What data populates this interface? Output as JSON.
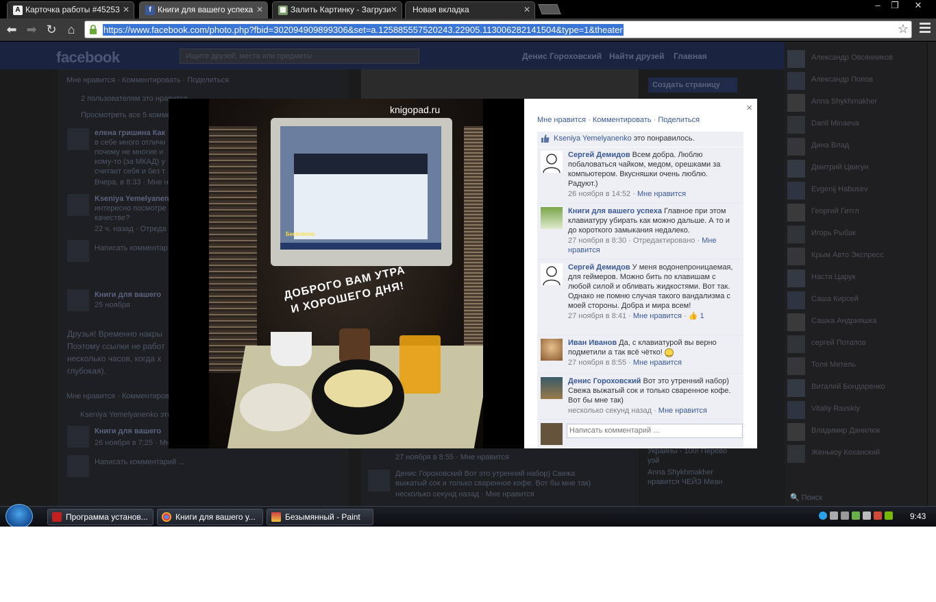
{
  "browser": {
    "tabs": [
      {
        "label": "Карточка работы #45253",
        "icon": "avast-favicon-icon"
      },
      {
        "label": "Книги для вашего успеха",
        "icon": "facebook-favicon-icon",
        "active": true
      },
      {
        "label": "Залить Картинку - Загрузи",
        "icon": "image-host-favicon-icon"
      },
      {
        "label": "Новая вкладка",
        "icon": ""
      }
    ],
    "url": "https://www.facebook.com/photo.php?fbid=302094909899306&set=a.125885557520243.22905.113006282141504&type=1&theater",
    "window_controls": [
      "–",
      "❐",
      "✕"
    ]
  },
  "background": {
    "logo": "facebook",
    "search_placeholder": "Ищите друзей, места или предметы",
    "header_user": "Денис Гороховский",
    "header_find": "Найти друзей",
    "header_home": "Главная",
    "create_page": "Создать страницу",
    "left_lines": [
      "Мне нравится · Комментировать · Поделиться",
      "2 пользователям это нравится.",
      "Просмотреть все 5 комментариев",
      "елена гришина Как",
      "в себе много отличн",
      "почему не многие и",
      "кому-то (за МКАД) у",
      "считает себя и без т",
      "Вчера, в 8:33 · Мне н",
      "Kseniya Yemelyanen",
      "интересно посмотре",
      "качестве?",
      "22 ч. назад · Отреда",
      "Написать комментар",
      "Книги для вашего",
      "25 ноября",
      "Друзья! Временно накры",
      "Поэтому ссылки не работ",
      "несколько часов, когда х",
      "глубокая).",
      "Мне нравится · Комментиров",
      "Kseniya Yemelyanenko это",
      "Книги для вашего",
      "26 ноября в 7:25 · Мн",
      "Написать комментарий ..."
    ],
    "right_lines": [
      "27 ноября в 8:55 · Мне нравится",
      "Денис Гороховский Вот это утренний набор) Свежа",
      "выжатый сок и только сваренное кофе. Вот бы мне так)",
      "несколько секунд назад · Мне нравится"
    ],
    "ad_lines": [
      "Украины - 100! Перево",
      "уэй",
      "Anna Shykhmakher",
      "нравится ЧЕЙЗ Меан"
    ],
    "chat_contacts": [
      "Александр Овсянников",
      "Александр Попов",
      "Anna Shykhmakher",
      "Danil Minaeva",
      "Дина Влад",
      "Дмитрий Цвигун",
      "Evgenij Habusev",
      "Георгий Гитгл",
      "Игорь Рыбак",
      "Крым Авто Экспресс",
      "Настя Царук",
      "Саша Кирсей",
      "Сашка Андрияшка",
      "сергей Потапов",
      "Толя Метель",
      "Виталий Бондаренко",
      "Vitaliy Ravskiy",
      "Владимир Данилюк",
      "Женькоу Коханский"
    ],
    "chat_search": "Поиск"
  },
  "photo": {
    "watermark": "knigopad.ru",
    "greeting_line1": "ДОБРОГО ВАМ УТРА",
    "greeting_line2": "И ХОРОШЕГО ДНЯ!",
    "screen_text": "Бесплатно"
  },
  "panel": {
    "close": "×",
    "actions": {
      "like": "Мне нравится",
      "comment": "Комментировать",
      "share": "Поделиться"
    },
    "likes": {
      "name": "Kseniya Yemelyanenko",
      "text": "это понравилось."
    },
    "comments": [
      {
        "author": "Сергей Демидов",
        "text": "Всем добра. Люблю побаловаться чайком, медом, орешками за компьютером. Вкусняшки очень люблю. Радуют.)",
        "time": "26 ноября в 14:52",
        "extra": "",
        "like": "Мне нравится",
        "count": ""
      },
      {
        "author": "Книги для вашего успеха",
        "text": "Главное при этом клавиатуру убирать как можно дальше. А то и до короткого замыкания недалеко.",
        "time": "27 ноября в 8:30",
        "extra": "Отредактировано",
        "like": "Мне нравится",
        "count": ""
      },
      {
        "author": "Сергей Демидов",
        "text": "У меня водонепроницаемая, для геймеров. Можно бить по клавишам с любой силой и обливать жидкостями. Вот так. Однако не помню случая такого вандализма с моей стороны. Добра и мира всем!",
        "time": "27 ноября в 8:41",
        "extra": "",
        "like": "Мне нравится",
        "count": "1"
      },
      {
        "author": "Иван Иванов",
        "text": "Да, с клавиатурой вы верно подметили а так всё чётко!",
        "time": "27 ноября в 8:55",
        "extra": "",
        "like": "Мне нравится",
        "count": ""
      },
      {
        "author": "Денис Гороховский",
        "text": "Вот это утренний набор) Свежа выжатый сок и только сваренное кофе. Вот бы мне так)",
        "time": "несколько секунд назад",
        "extra": "",
        "like": "Мне нравится",
        "count": ""
      }
    ],
    "write_placeholder": "Написать комментарий ..."
  },
  "taskbar": {
    "items": [
      {
        "label": "Программа установ...",
        "icon": "flash-installer-icon"
      },
      {
        "label": "Книги для вашего у...",
        "icon": "chrome-icon"
      },
      {
        "label": "Безымянный - Paint",
        "icon": "paint-icon"
      }
    ],
    "clock": "9:43"
  },
  "colors": {
    "fb_blue": "#3b5998",
    "panel_bg": "#edeff4",
    "url_highlight": "#3875d7"
  }
}
